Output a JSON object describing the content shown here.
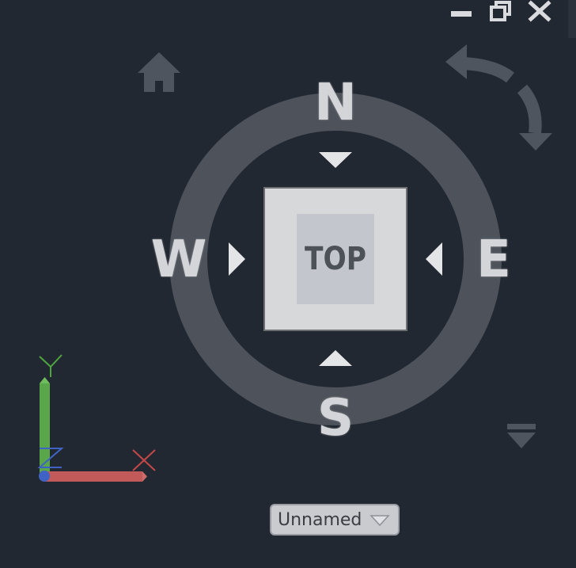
{
  "window_controls": {
    "minimize_icon": "minimize-icon",
    "restore_icon": "restore-icon",
    "close_icon": "close-icon"
  },
  "viewcube": {
    "face_label": "TOP",
    "compass": {
      "north": "N",
      "south": "S",
      "east": "E",
      "west": "W"
    },
    "home_icon": "home-icon",
    "rotate_icon": "rotate-arrow-icon",
    "menu_icon": "viewcube-menu-icon"
  },
  "ucs_icon": {
    "x_label_icon": "x-axis-icon",
    "y_label_icon": "y-axis-icon"
  },
  "coordinate_system_dropdown": {
    "selected": "Unnamed"
  },
  "colors": {
    "background": "#222831",
    "compass_ring": "#4e535b",
    "cube_face": "#c3c7cd",
    "x_axis": "#c35a5a",
    "y_axis": "#5aa64a",
    "z_axis": "#3f63c4"
  }
}
